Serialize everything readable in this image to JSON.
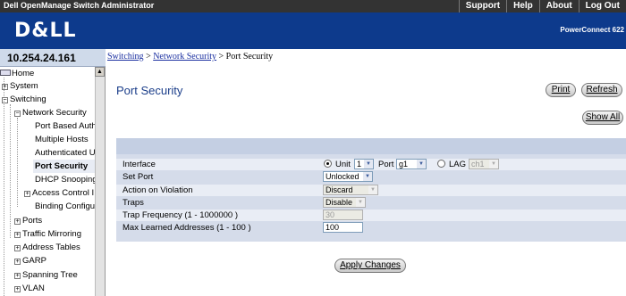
{
  "header": {
    "app_title": "Dell OpenManage Switch Administrator",
    "links": [
      "Support",
      "Help",
      "About",
      "Log Out"
    ],
    "logo": "D&LL",
    "model": "PowerConnect 622"
  },
  "ip_address": "10.254.24.161",
  "breadcrumb": {
    "switching": "Switching",
    "sep1": " > ",
    "network_security": "Network Security",
    "sep2": " > Port Security"
  },
  "sidebar": {
    "items": [
      {
        "label": "Home",
        "type": "home"
      },
      {
        "label": "System",
        "type": "plus"
      },
      {
        "label": "Switching",
        "type": "minus"
      },
      {
        "label": "Network Security",
        "type": "minus"
      },
      {
        "label": "Port Based Auth",
        "type": "leaf"
      },
      {
        "label": "Multiple Hosts",
        "type": "leaf"
      },
      {
        "label": "Authenticated U",
        "type": "leaf"
      },
      {
        "label": "Port Security",
        "type": "leaf"
      },
      {
        "label": "DHCP Snooping",
        "type": "leaf"
      },
      {
        "label": "Access Control I",
        "type": "plus"
      },
      {
        "label": "Binding Configur",
        "type": "leaf"
      },
      {
        "label": "Ports",
        "type": "plus"
      },
      {
        "label": "Traffic Mirroring",
        "type": "plus"
      },
      {
        "label": "Address Tables",
        "type": "plus"
      },
      {
        "label": "GARP",
        "type": "plus"
      },
      {
        "label": "Spanning Tree",
        "type": "plus"
      },
      {
        "label": "VLAN",
        "type": "plus"
      }
    ]
  },
  "main": {
    "title": "Port Security",
    "print_label": "Print",
    "refresh_label": "Refresh",
    "show_all_label": "Show All",
    "apply_label": "Apply Changes",
    "form": {
      "interface_label": "Interface",
      "unit_label": "Unit",
      "unit_value": "1",
      "port_label": "Port",
      "port_value": "g1",
      "lag_label": "LAG",
      "lag_value": "ch1",
      "set_port_label": "Set Port",
      "set_port_value": "Unlocked",
      "action_label": "Action on Violation",
      "action_value": "Discard",
      "traps_label": "Traps",
      "traps_value": "Disable",
      "trap_freq_label": "Trap Frequency (1 - 1000000 )",
      "trap_freq_value": "30",
      "max_learned_label": "Max Learned Addresses (1 - 100 )",
      "max_learned_value": "100"
    }
  },
  "colors": {
    "brand_blue": "#0d3a8c",
    "title_blue": "#1b3e8a",
    "panel": "#d5dcea"
  }
}
